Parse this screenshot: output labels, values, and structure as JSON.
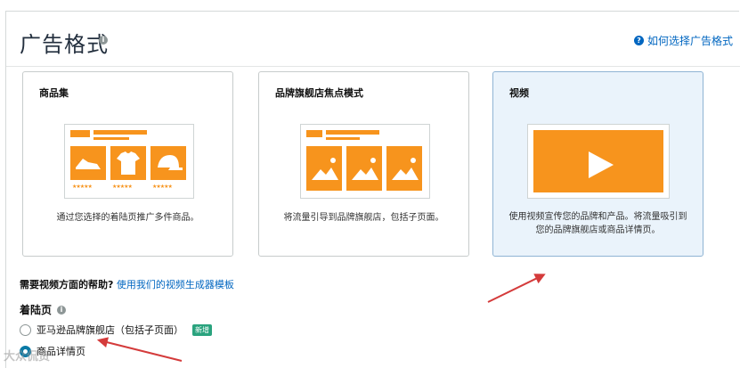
{
  "header": {
    "title": "广告格式",
    "help_link": "如何选择广告格式"
  },
  "cards": [
    {
      "title": "商品集",
      "description": "通过您选择的着陆页推广多件商品。",
      "selected": false
    },
    {
      "title": "品牌旗舰店焦点模式",
      "description": "将流量引导到品牌旗舰店，包括子页面。",
      "selected": false
    },
    {
      "title": "视频",
      "description": "使用视频宣传您的品牌和产品。将流量吸引到您的品牌旗舰店或商品详情页。",
      "selected": true
    }
  ],
  "video_help": {
    "question": "需要视频方面的帮助?",
    "link": "使用我们的视频生成器模板"
  },
  "landing_page": {
    "label": "着陆页",
    "options": [
      {
        "label": "亚马逊品牌旗舰店（包括子页面）",
        "badge": "新增",
        "checked": false
      },
      {
        "label": "商品详情页",
        "checked": true
      }
    ]
  },
  "watermark": "大众侃货",
  "colors": {
    "accent": "#f7941d",
    "link": "#0066c0",
    "selected_bg": "#eaf3fb",
    "arrow": "#d43b3b"
  }
}
